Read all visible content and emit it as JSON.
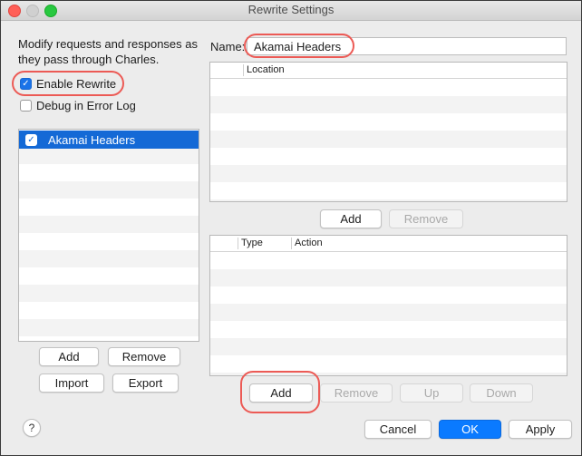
{
  "window": {
    "title": "Rewrite Settings"
  },
  "left": {
    "intro": "Modify requests and responses as they pass through Charles.",
    "enable_rewrite": {
      "label": "Enable Rewrite",
      "checked": true
    },
    "debug_log": {
      "label": "Debug in Error Log",
      "checked": false
    },
    "sets": [
      {
        "label": "Akamai Headers",
        "checked": true,
        "selected": true
      }
    ],
    "buttons": {
      "add": "Add",
      "remove": "Remove",
      "import": "Import",
      "export": "Export"
    }
  },
  "right": {
    "name_label": "Name:",
    "name_value": "Akamai Headers",
    "locations": {
      "header": "Location",
      "rows": [],
      "add": "Add",
      "remove": "Remove"
    },
    "rules": {
      "headers": [
        "Type",
        "Action"
      ],
      "rows": [],
      "add": "Add",
      "remove": "Remove",
      "up": "Up",
      "down": "Down"
    }
  },
  "footer": {
    "help": "?",
    "cancel": "Cancel",
    "ok": "OK",
    "apply": "Apply"
  },
  "colors": {
    "accent": "#1469d6",
    "highlight": "#ec5a55",
    "ok_button": "#0a7aff"
  },
  "icons": [
    "checkmark-icon",
    "help-icon"
  ]
}
